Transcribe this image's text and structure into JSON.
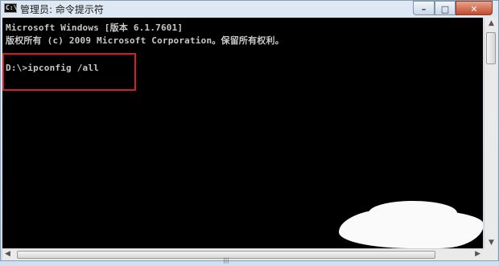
{
  "window": {
    "title": "管理员: 命令提示符",
    "icon": "cmd-icon",
    "icon_text": "C:\\",
    "buttons": {
      "minimize": "–",
      "maximize": "□",
      "close": "✕"
    }
  },
  "console": {
    "lines": [
      "Microsoft Windows [版本 6.1.7601]",
      "版权所有 (c) 2009 Microsoft Corporation。保留所有权利。",
      "D:\\>ipconfig /all"
    ],
    "background": "#000000",
    "text_color": "#c8c8c8",
    "highlight_color": "#d41f26"
  },
  "scrollbars": {
    "up_arrow": "▲",
    "down_arrow": "▼",
    "left_arrow": "◀",
    "right_arrow": "▶",
    "thumb_grip": "|||"
  }
}
